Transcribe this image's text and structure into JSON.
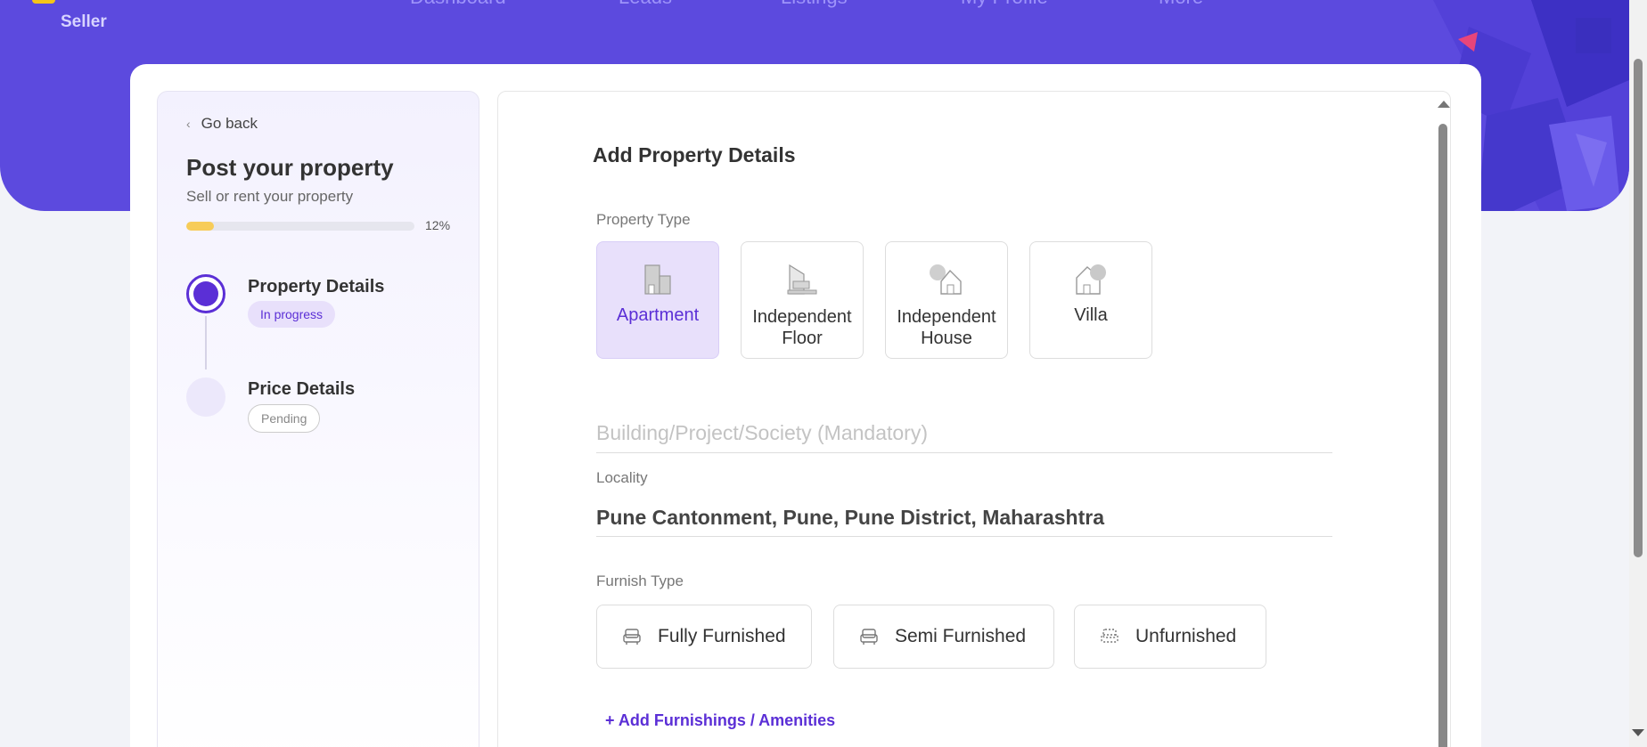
{
  "header": {
    "role_label": "Seller",
    "nav": [
      "Dashboard",
      "Leads",
      "Listings",
      "My Profile",
      "More"
    ]
  },
  "sidebar": {
    "go_back": "Go back",
    "title": "Post your property",
    "subtitle": "Sell or rent your property",
    "progress_percent": 12,
    "progress_label": "12%",
    "steps": [
      {
        "title": "Property Details",
        "status": "In progress"
      },
      {
        "title": "Price Details",
        "status": "Pending"
      }
    ]
  },
  "form": {
    "title": "Add Property Details",
    "property_type_label": "Property Type",
    "property_types": [
      {
        "label": "Apartment",
        "icon": "apartment-icon",
        "selected": true
      },
      {
        "label": "Independent Floor",
        "icon": "independent-floor-icon",
        "selected": false
      },
      {
        "label": "Independent House",
        "icon": "independent-house-icon",
        "selected": false
      },
      {
        "label": "Villa",
        "icon": "villa-icon",
        "selected": false
      }
    ],
    "building_placeholder": "Building/Project/Society (Mandatory)",
    "locality_label": "Locality",
    "locality_value": "Pune Cantonment, Pune, Pune District, Maharashtra",
    "furnish_label": "Furnish Type",
    "furnish_options": [
      {
        "label": "Fully Furnished",
        "icon": "sofa-icon"
      },
      {
        "label": "Semi Furnished",
        "icon": "sofa-icon"
      },
      {
        "label": "Unfurnished",
        "icon": "empty-sofa-icon"
      }
    ],
    "add_amenities": "+ Add Furnishings / Amenities"
  },
  "colors": {
    "brand": "#5c4ade",
    "accent": "#5b2fd6",
    "progress": "#f7cc58"
  }
}
